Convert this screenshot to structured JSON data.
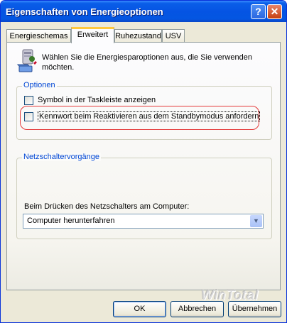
{
  "window": {
    "title": "Eigenschaften von Energieoptionen",
    "help_label": "?",
    "close_label": "✕"
  },
  "tabs": [
    {
      "label": "Energieschemas",
      "active": false
    },
    {
      "label": "Erweitert",
      "active": true
    },
    {
      "label": "Ruhezustand",
      "active": false
    },
    {
      "label": "USV",
      "active": false
    }
  ],
  "info": {
    "text_line1": "Wählen Sie die Energiesparoptionen aus, die Sie verwenden",
    "text_line2": "möchten.",
    "icon": "power-options-icon"
  },
  "optionen": {
    "label": "Optionen",
    "checkbox1": {
      "label": "Symbol in der Taskleiste anzeigen",
      "checked": false
    },
    "checkbox2": {
      "label": "Kennwort beim Reaktivieren aus dem Standbymodus anfordern",
      "checked": false
    }
  },
  "netz": {
    "label": "Netzschaltervorgänge",
    "prompt": "Beim Drücken des Netzschalters am Computer:",
    "selected": "Computer herunterfahren"
  },
  "buttons": {
    "ok": "OK",
    "cancel": "Abbrechen",
    "apply": "Übernehmen"
  },
  "watermark": "WinTotal",
  "colors": {
    "accent_highlight": "#e43a3a",
    "group_label": "#0046d5"
  }
}
